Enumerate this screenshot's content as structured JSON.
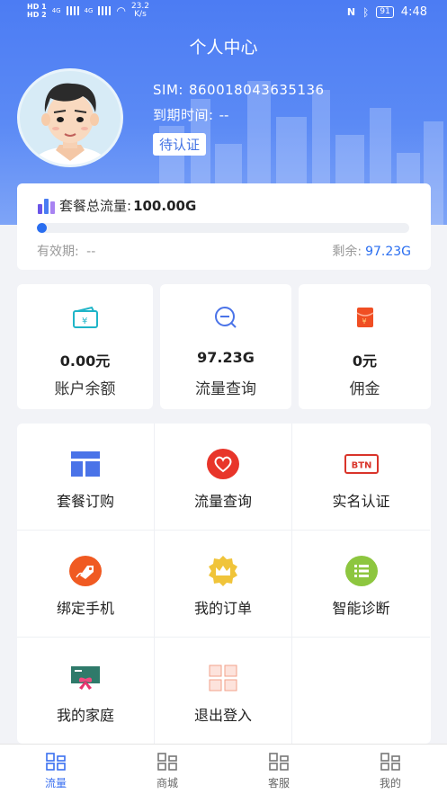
{
  "status_bar": {
    "sim1": "HD 1",
    "sim2": "HD 2",
    "signal1": "4G",
    "signal2": "4G",
    "speed_value": "23.2",
    "speed_unit": "K/s",
    "battery": "91",
    "time": "4:48"
  },
  "header": {
    "title": "个人中心"
  },
  "profile": {
    "sim_label": "SIM:",
    "sim_value": "860018043635136",
    "expire_label": "到期时间:",
    "expire_value": "--",
    "verify_button": "待认证"
  },
  "plan": {
    "title": "套餐总流量:",
    "total": "100.00G",
    "usage_fraction": 0.0277,
    "validity_label": "有效期:",
    "validity_value": "--",
    "remaining_label": "剩余:",
    "remaining_value": "97.23G"
  },
  "stats": [
    {
      "value": "0.00元",
      "label": "账户余额",
      "icon": "wallet-icon"
    },
    {
      "value": "97.23G",
      "label": "流量查询",
      "icon": "search-data-icon"
    },
    {
      "value": "0元",
      "label": "佣金",
      "icon": "red-envelope-icon"
    }
  ],
  "menu": [
    {
      "label": "套餐订购",
      "icon": "layout-icon"
    },
    {
      "label": "流量查询",
      "icon": "heart-icon"
    },
    {
      "label": "实名认证",
      "icon": "btn-icon",
      "icon_text": "BTN"
    },
    {
      "label": "绑定手机",
      "icon": "tag-icon"
    },
    {
      "label": "我的订单",
      "icon": "crown-badge-icon"
    },
    {
      "label": "智能诊断",
      "icon": "list-icon"
    },
    {
      "label": "我的家庭",
      "icon": "gift-card-icon"
    },
    {
      "label": "退出登入",
      "icon": "grid-icon"
    }
  ],
  "tabs": [
    {
      "label": "流量",
      "active": true
    },
    {
      "label": "商城",
      "active": false
    },
    {
      "label": "客服",
      "active": false
    },
    {
      "label": "我的",
      "active": false
    }
  ],
  "colors": {
    "primary": "#3a6ff0",
    "header": "#4c7cf3",
    "heart": "#e8352a",
    "tag": "#f05a22",
    "list": "#8dc63f"
  }
}
